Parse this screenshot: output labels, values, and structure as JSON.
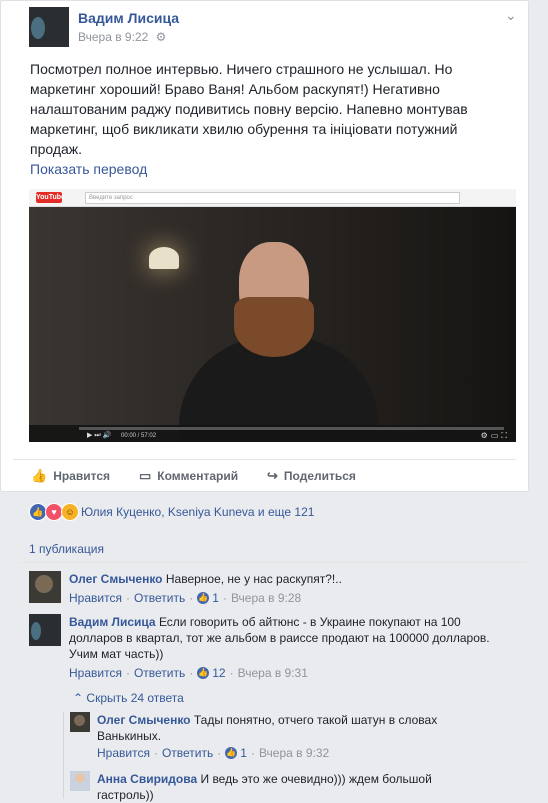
{
  "post": {
    "author": "Вадим Лисица",
    "time": "Вчера в 9:22",
    "privacy_icon": "settings-icon",
    "text": "Посмотрел полное интервью. Ничего страшного не услышал. Но маркетинг хороший! Браво Ваня! Альбом раскупят!) Негативно налаштованим раджу подивитись повну версію. Напевно монтував маркетинг, щоб викликати хвилю обурення та ініціовати потужний продаж.",
    "translate_link": "Показать перевод",
    "chevron_icon": "chevron-down-icon"
  },
  "video": {
    "logo": "YouTube",
    "search_placeholder": "Введите запрос",
    "time": "00:00 / 57:02",
    "progress": 0.0
  },
  "actions": {
    "like": "Нравится",
    "comment": "Комментарий",
    "share": "Поделиться"
  },
  "reactions": {
    "names": "Юлия Куценко, Kseniya Kuneva и еще 121"
  },
  "publications": "1 публикация",
  "comments": [
    {
      "author": "Олег Смыченко",
      "text": "Наверное, не у нас раскупят?!..",
      "like_label": "Нравится",
      "reply_label": "Ответить",
      "likes": "1",
      "time": "Вчера в 9:28"
    },
    {
      "author": "Вадим Лисица",
      "text": "Если говорить об айтюнс - в Украине покупают на 100 долларов в квартал, тот же альбом в раиссе продают на 100000 долларов. Учим мат часть))",
      "like_label": "Нравится",
      "reply_label": "Ответить",
      "likes": "12",
      "time": "Вчера в 9:31",
      "replies_toggle": "Скрыть 24 ответа"
    }
  ],
  "replies": [
    {
      "author": "Олег Смыченко",
      "text": "Тады понятно, отчего такой шатун в словах Ванькиных.",
      "like_label": "Нравится",
      "reply_label": "Ответить",
      "likes": "1",
      "time": "Вчера в 9:32"
    },
    {
      "author": "Анна Свиридова",
      "text": "И ведь это же очевидно))) ждем большой гастроль))"
    }
  ],
  "colors": {
    "link": "#365899",
    "muted": "#90949c",
    "like_blue": "#4267b2"
  }
}
